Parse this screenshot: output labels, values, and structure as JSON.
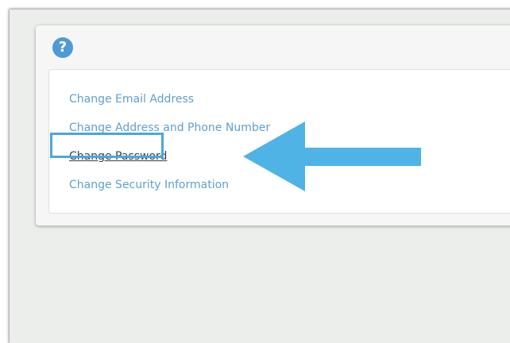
{
  "help": {
    "icon": "help-icon",
    "glyph": "?"
  },
  "links": [
    {
      "label": "Change Email Address",
      "active": false
    },
    {
      "label": "Change Address and Phone Number",
      "active": false
    },
    {
      "label": "Change Password",
      "active": true
    },
    {
      "label": "Change Security Information",
      "active": false
    }
  ],
  "colors": {
    "link": "#5fa0d0",
    "active_link": "#3a3f44",
    "highlight": "#4aa7dd",
    "arrow": "#4fb3e6",
    "help_icon": "#4f9ad4"
  }
}
